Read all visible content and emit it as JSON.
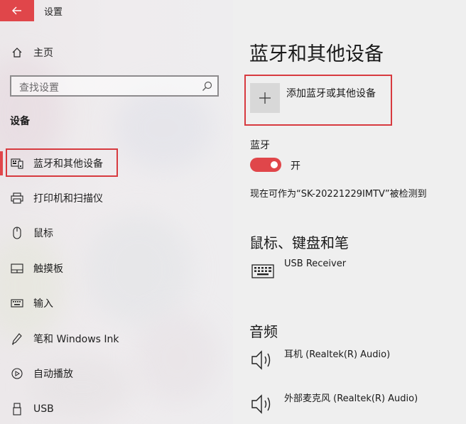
{
  "window": {
    "title": "设置"
  },
  "sidebar": {
    "home_label": "主页",
    "search_placeholder": "查找设置",
    "section_heading": "设备",
    "items": [
      {
        "label": "蓝牙和其他设备",
        "icon": "bluetooth-devices-icon",
        "active": true
      },
      {
        "label": "打印机和扫描仪",
        "icon": "printer-icon",
        "active": false
      },
      {
        "label": "鼠标",
        "icon": "mouse-icon",
        "active": false
      },
      {
        "label": "触摸板",
        "icon": "touchpad-icon",
        "active": false
      },
      {
        "label": "输入",
        "icon": "keyboard-input-icon",
        "active": false
      },
      {
        "label": "笔和 Windows Ink",
        "icon": "pen-icon",
        "active": false
      },
      {
        "label": "自动播放",
        "icon": "autoplay-icon",
        "active": false
      },
      {
        "label": "USB",
        "icon": "usb-icon",
        "active": false
      }
    ]
  },
  "main": {
    "page_title": "蓝牙和其他设备",
    "add_device_label": "添加蓝牙或其他设备",
    "bluetooth": {
      "heading": "蓝牙",
      "toggle_state": "开",
      "toggle_on": true,
      "discoverable_text": "现在可作为“SK-20221229IMTV”被检测到"
    },
    "mouse_keyboard_pen": {
      "heading": "鼠标、键盘和笔",
      "devices": [
        {
          "name": "USB Receiver",
          "icon": "keyboard-icon"
        }
      ]
    },
    "audio": {
      "heading": "音频",
      "devices": [
        {
          "name": "耳机 (Realtek(R) Audio)",
          "icon": "speaker-icon"
        },
        {
          "name": "外部麦克风 (Realtek(R) Audio)",
          "icon": "speaker-icon"
        }
      ]
    }
  },
  "colors": {
    "accent": "#e0464a",
    "highlight_border": "#d73a3f",
    "right_background": "#efefef"
  }
}
